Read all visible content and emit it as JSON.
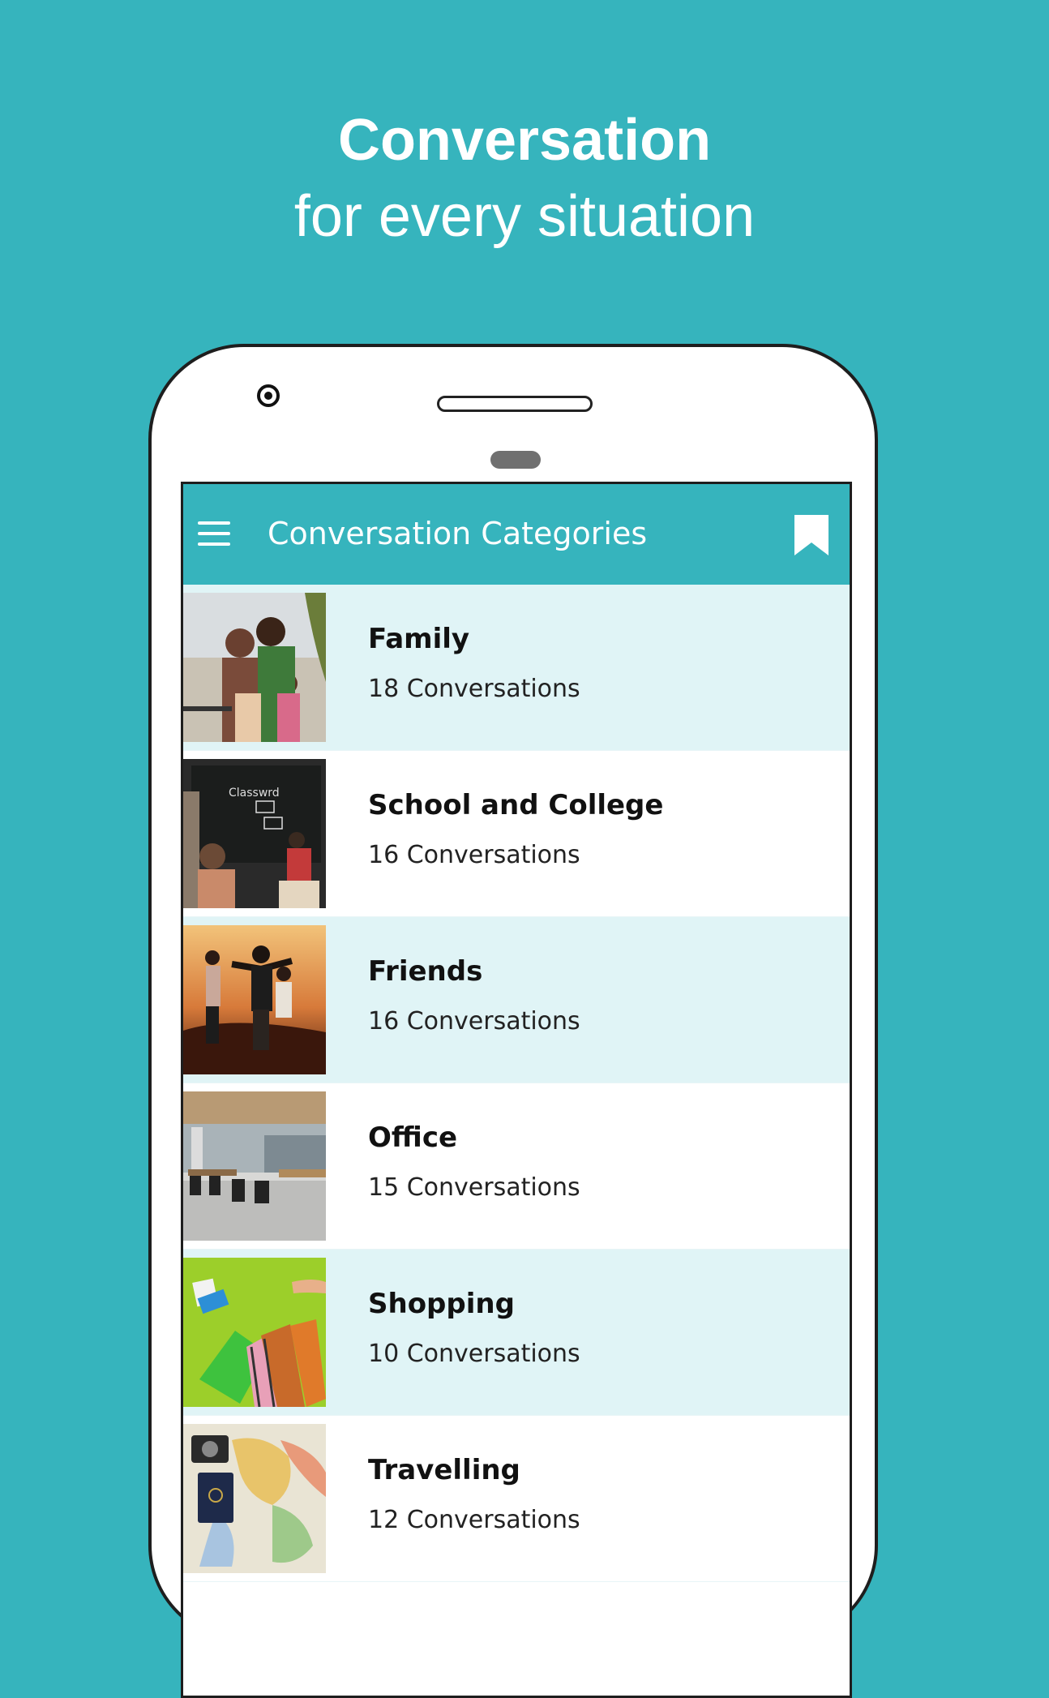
{
  "promo": {
    "title": "Conversation",
    "subtitle": "for every situation"
  },
  "app_bar": {
    "title": "Conversation Categories",
    "menu_icon": "menu-icon",
    "bookmark_icon": "bookmark-icon"
  },
  "colors": {
    "brand": "#36b4bd",
    "row_highlight": "#e0f4f6",
    "row_plain": "#ffffff"
  },
  "categories": [
    {
      "title": "Family",
      "count": "18 Conversations",
      "image": "family-photo"
    },
    {
      "title": "School and College",
      "count": "16 Conversations",
      "image": "classroom-photo"
    },
    {
      "title": "Friends",
      "count": "16 Conversations",
      "image": "friends-photo"
    },
    {
      "title": "Office",
      "count": "15 Conversations",
      "image": "office-photo"
    },
    {
      "title": "Shopping",
      "count": "10 Conversations",
      "image": "shopping-photo"
    },
    {
      "title": "Travelling",
      "count": "12 Conversations",
      "image": "travel-map-photo"
    }
  ]
}
